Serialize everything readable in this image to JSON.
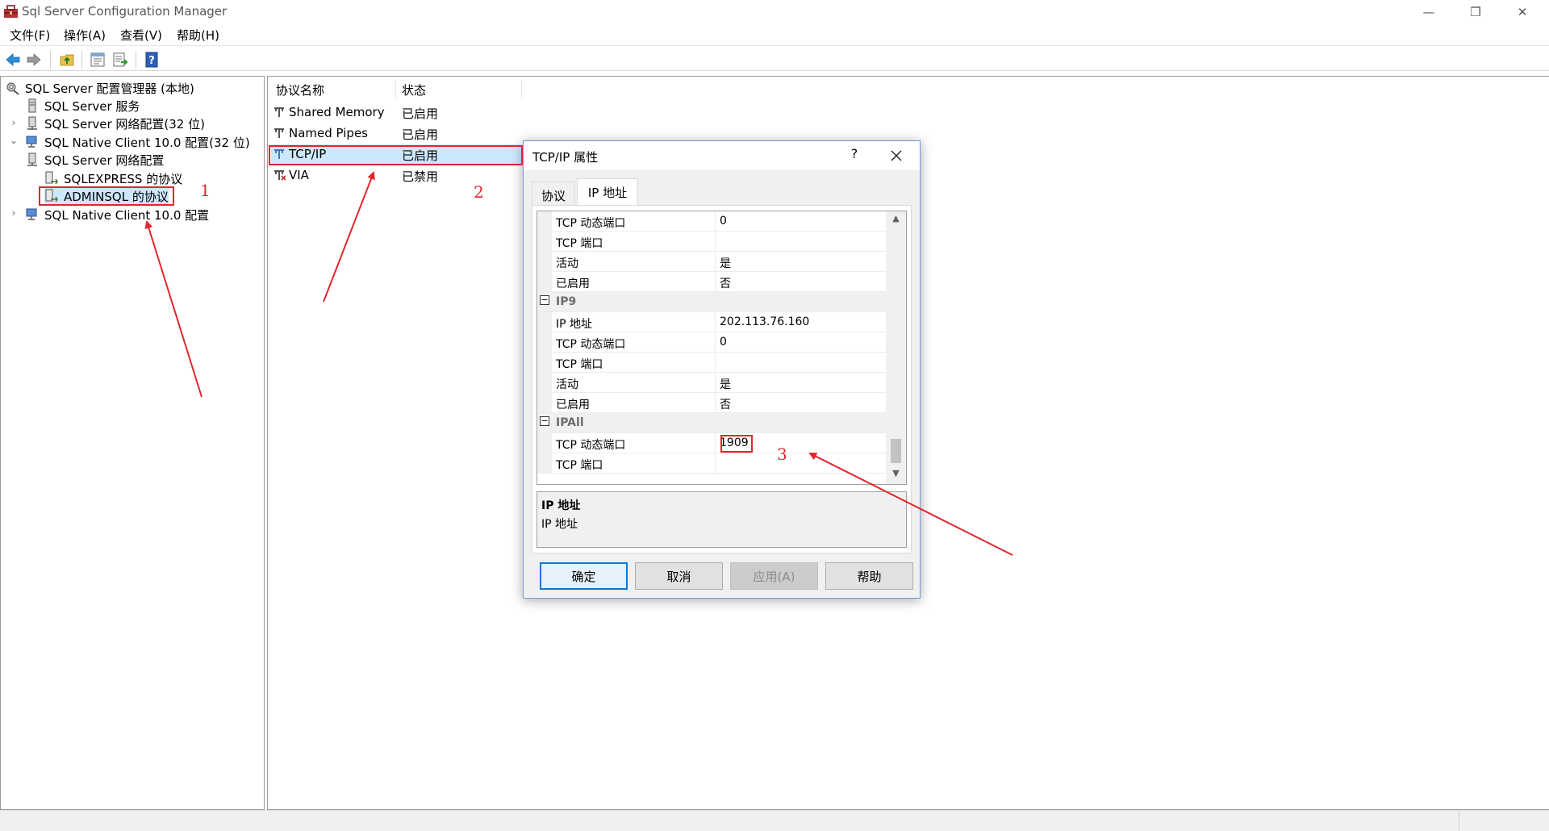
{
  "window": {
    "title": "Sql Server Configuration Manager",
    "min_glyph": "—",
    "max_glyph": "❐",
    "close_glyph": "✕"
  },
  "menu": {
    "items": [
      "文件(F)",
      "操作(A)",
      "查看(V)",
      "帮助(H)"
    ]
  },
  "toolbar": {
    "icons": [
      "back-arrow-icon",
      "forward-arrow-icon",
      "up-folder-icon",
      "properties-icon",
      "export-list-icon",
      "help-book-icon"
    ]
  },
  "tree": {
    "root": "SQL Server 配置管理器 (本地)",
    "items": [
      "SQL Server 服务",
      "SQL Server 网络配置(32 位)",
      "SQL Native Client 10.0 配置(32 位)",
      "SQL Server 网络配置",
      "SQLEXPRESS 的协议",
      "ADMINSQL 的协议",
      "SQL Native Client 10.0 配置"
    ],
    "collapsed_glyph": "›",
    "expanded_glyph": "⌄"
  },
  "protocols": {
    "col_name": "协议名称",
    "col_state": "状态",
    "rows": [
      {
        "name": "Shared Memory",
        "state": "已启用"
      },
      {
        "name": "Named Pipes",
        "state": "已启用"
      },
      {
        "name": "TCP/IP",
        "state": "已启用"
      },
      {
        "name": "VIA",
        "state": "已禁用"
      }
    ]
  },
  "dialog": {
    "title": "TCP/IP 属性",
    "help_glyph": "?",
    "tabs": [
      "协议",
      "IP 地址"
    ],
    "grid": [
      {
        "name": "TCP 动态端口",
        "value": "0"
      },
      {
        "name": "TCP 端口",
        "value": ""
      },
      {
        "name": "活动",
        "value": "是"
      },
      {
        "name": "已启用",
        "value": "否"
      },
      {
        "name": "IP9",
        "category": true
      },
      {
        "name": "IP 地址",
        "value": "202.113.76.160"
      },
      {
        "name": "TCP 动态端口",
        "value": "0"
      },
      {
        "name": "TCP 端口",
        "value": ""
      },
      {
        "name": "活动",
        "value": "是"
      },
      {
        "name": "已启用",
        "value": "否"
      },
      {
        "name": "IPAll",
        "category": true
      },
      {
        "name": "TCP 动态端口",
        "value": "1909"
      },
      {
        "name": "TCP 端口",
        "value": ""
      }
    ],
    "expander_glyph": "−",
    "scroll_up_glyph": "▲",
    "scroll_down_glyph": "▼",
    "description": {
      "title": "IP 地址",
      "text": "IP 地址"
    },
    "buttons": {
      "ok": "确定",
      "cancel": "取消",
      "apply": "应用(A)",
      "help": "帮助"
    }
  },
  "annotations": {
    "labels": [
      "1",
      "2",
      "3"
    ],
    "color": "#e0262d"
  }
}
